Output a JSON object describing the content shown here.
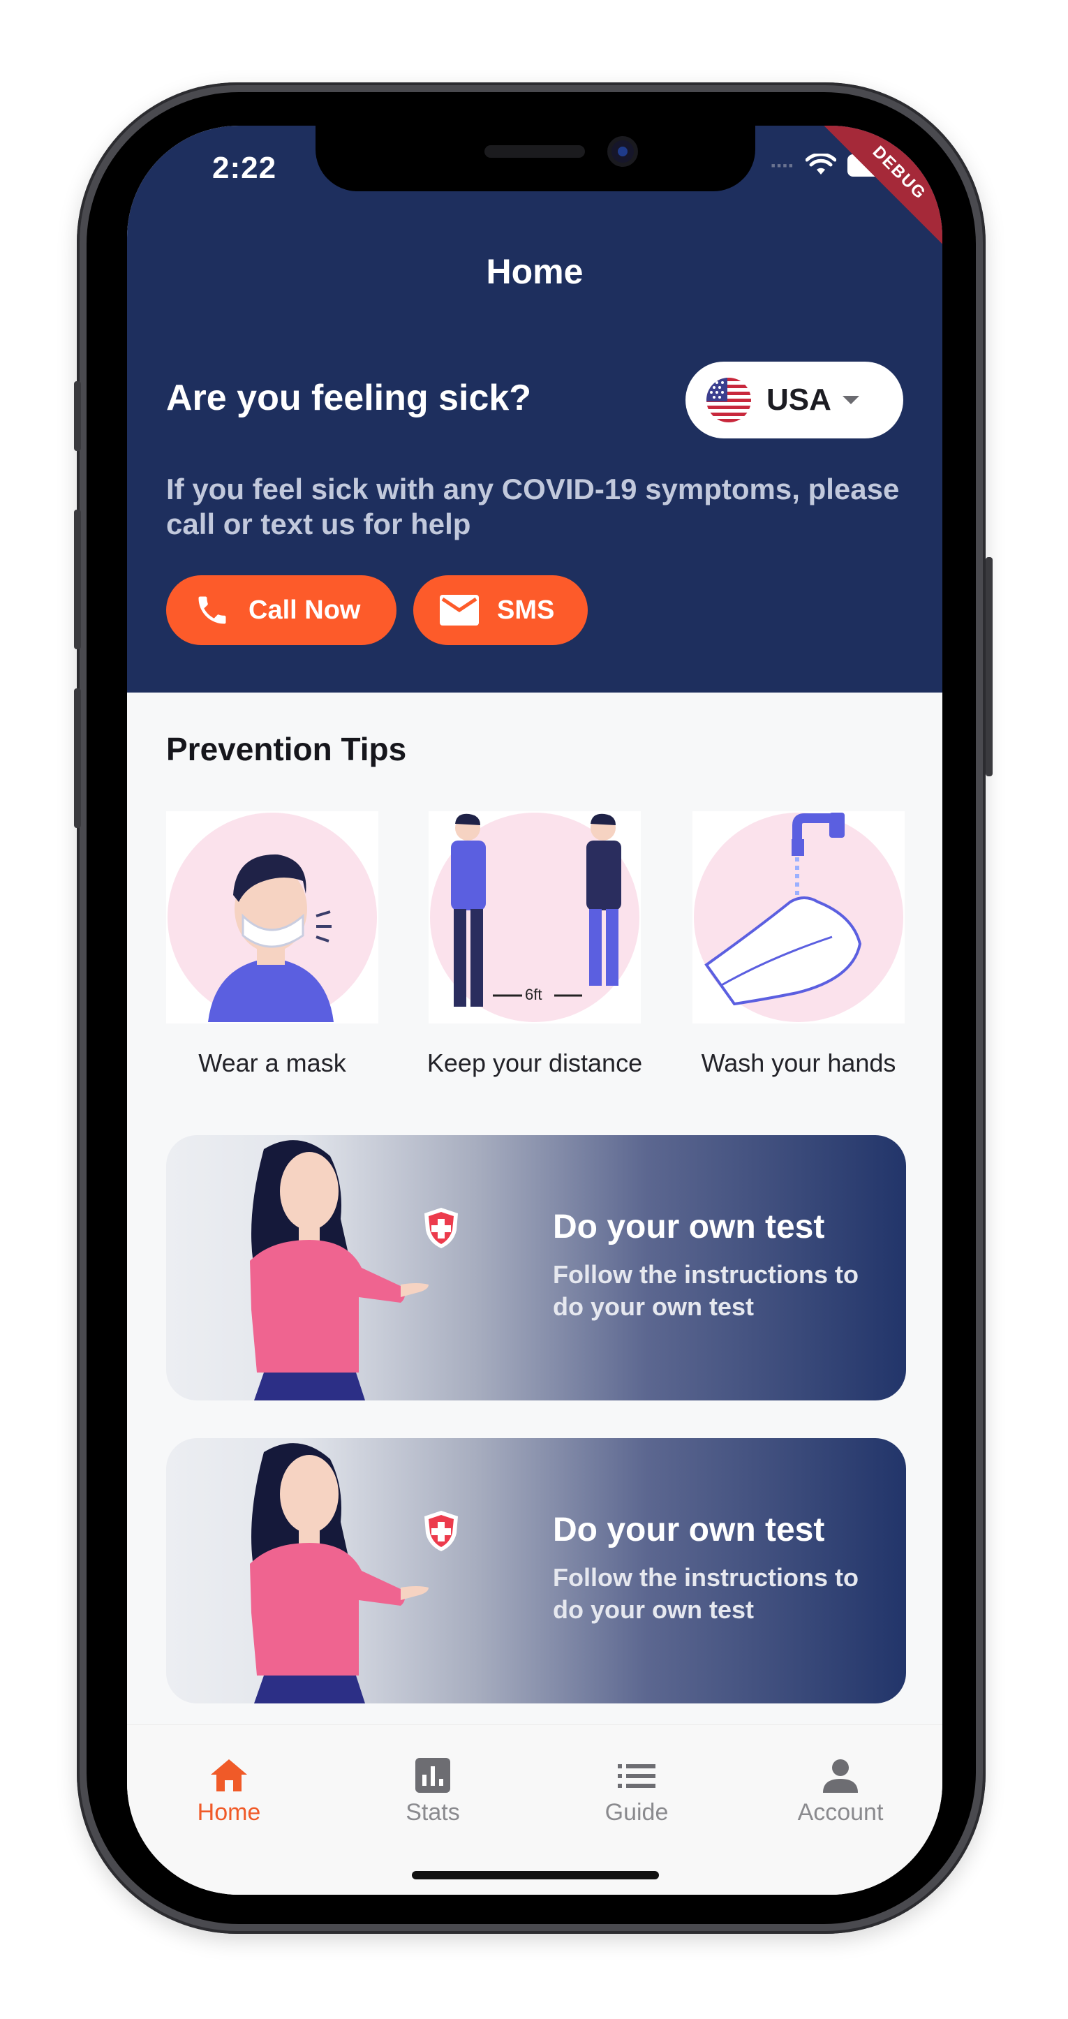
{
  "status_bar": {
    "time": "2:22",
    "debug_label": "DEBUG"
  },
  "header": {
    "title": "Home",
    "sick_title": "Are you feeling sick?",
    "description": "If you feel sick with any COVID-19 symptoms, please call or text us for help",
    "country": {
      "selected": "USA",
      "flag_icon": "us-flag-icon"
    },
    "buttons": {
      "call_label": "Call Now",
      "sms_label": "SMS"
    }
  },
  "prevention": {
    "title": "Prevention Tips",
    "tips": [
      {
        "label": "Wear a mask"
      },
      {
        "label": "Keep your distance",
        "distance_text": "6ft"
      },
      {
        "label": "Wash your hands"
      }
    ]
  },
  "banners": [
    {
      "title": "Do your own test",
      "subtitle": "Follow the instructions to do your own test"
    },
    {
      "title": "Do your own test",
      "subtitle": "Follow the instructions to do your own test"
    }
  ],
  "bottom_nav": {
    "active": "Home",
    "items": [
      {
        "label": "Home",
        "icon": "home-icon"
      },
      {
        "label": "Stats",
        "icon": "stats-icon"
      },
      {
        "label": "Guide",
        "icon": "guide-list-icon"
      },
      {
        "label": "Account",
        "icon": "account-icon"
      }
    ]
  },
  "colors": {
    "header_bg": "#1e2f5e",
    "accent": "#fd5b2a",
    "active_nav": "#f05a28",
    "tip_circle": "#fbe2ec"
  }
}
